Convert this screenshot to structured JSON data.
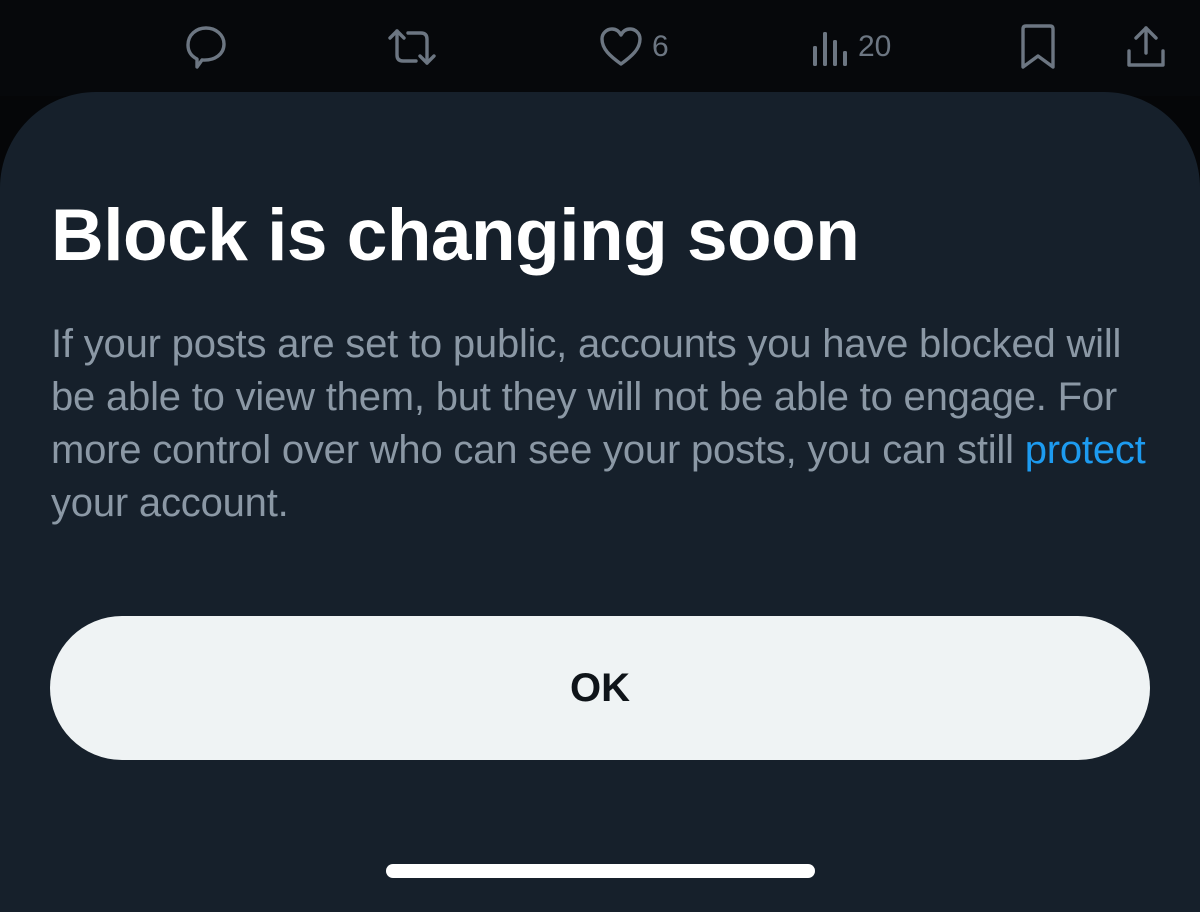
{
  "action_bar": {
    "reply_icon": "reply-icon",
    "repost_icon": "repost-icon",
    "like_icon": "heart-icon",
    "like_count": "6",
    "views_icon": "analytics-icon",
    "views_count": "20",
    "bookmark_icon": "bookmark-icon",
    "share_icon": "share-icon"
  },
  "dialog": {
    "title": "Block is changing soon",
    "body_before_link": "If your posts are set to public, accounts you have blocked will be able to view them, but they will not be able to engage. For more control over who can see your posts, you can still ",
    "link_text": "protect",
    "body_after_link": " your account.",
    "ok_label": "OK"
  },
  "colors": {
    "background": "#050608",
    "sheet": "#16202b",
    "title_text": "#ffffff",
    "body_text": "#8b98a5",
    "link": "#1d9bf0",
    "button_bg": "#eff3f4",
    "button_text": "#0f1419",
    "icon": "#6c7682"
  }
}
